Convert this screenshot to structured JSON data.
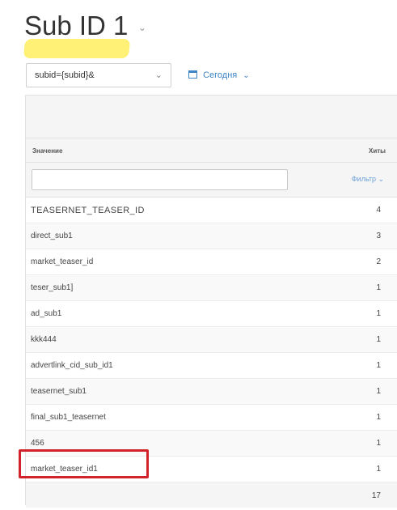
{
  "header": {
    "title": "Sub ID 1",
    "title_caret": "⌄"
  },
  "toolbar": {
    "subid_select_value": "subid={subid}&",
    "subid_select_chevron": "⌄",
    "date_label": "Сегодня",
    "date_chevron": "⌄"
  },
  "table": {
    "columns": {
      "value": "Значение",
      "hits": "Хиты"
    },
    "filter": {
      "placeholder": "",
      "button_label": "Фильтр ⌄"
    },
    "rows": [
      {
        "value": "TEASERNET_TEASER_ID",
        "hits": "4"
      },
      {
        "value": "direct_sub1",
        "hits": "3"
      },
      {
        "value": "market_teaser_id",
        "hits": "2"
      },
      {
        "value": "teser_sub1]",
        "hits": "1"
      },
      {
        "value": "ad_sub1",
        "hits": "1"
      },
      {
        "value": "kkk444",
        "hits": "1"
      },
      {
        "value": "advertlink_cid_sub_id1",
        "hits": "1"
      },
      {
        "value": "teasernet_sub1",
        "hits": "1"
      },
      {
        "value": "final_sub1_teasernet",
        "hits": "1"
      },
      {
        "value": "456",
        "hits": "1"
      },
      {
        "value": "market_teaser_id1",
        "hits": "1"
      }
    ],
    "total": "17"
  },
  "colors": {
    "accent": "#3d85c6",
    "highlight": "#fff176",
    "annotation_box": "#d2232a"
  },
  "icons": [
    "chevron-down-icon",
    "calendar-icon"
  ]
}
